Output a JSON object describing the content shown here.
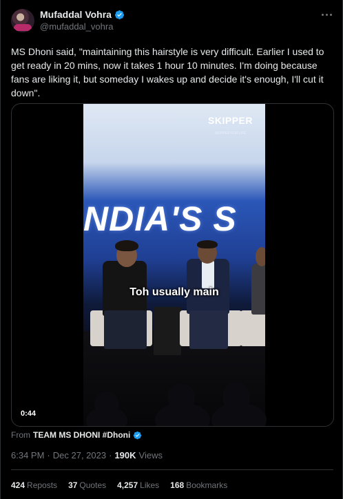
{
  "author": {
    "display_name": "Mufaddal Vohra",
    "handle": "@mufaddal_vohra",
    "verified_color": "#1d9bf0"
  },
  "tweet": {
    "text": "MS Dhoni said, \"maintaining this hairstyle is very difficult. Earlier I used to get ready in 20 mins, now it takes 1 hour 10 minutes. I'm doing because fans are liking it, but someday I wakes up and decide it's enough, I'll cut it down\"."
  },
  "video": {
    "brand_name": "SKIPPER",
    "brand_sub": "PIPES",
    "brand_tag": "SKIPPER FOR LIFE",
    "stage_text": "NDIA'S S",
    "subtitle": "Toh usually main",
    "duration": "0:44"
  },
  "source": {
    "prefix": "From",
    "community": "TEAM MS DHONI #Dhoni"
  },
  "meta": {
    "time": "6:34 PM",
    "sep1": "·",
    "date": "Dec 27, 2023",
    "sep2": "·",
    "views_count": "190K",
    "views_label": "Views"
  },
  "stats": [
    {
      "count": "424",
      "label": "Reposts"
    },
    {
      "count": "37",
      "label": "Quotes"
    },
    {
      "count": "4,257",
      "label": "Likes"
    },
    {
      "count": "168",
      "label": "Bookmarks"
    }
  ],
  "icons": {
    "avatar": "avatar",
    "verified": "verified-badge-icon",
    "more": "more-options-icon"
  }
}
